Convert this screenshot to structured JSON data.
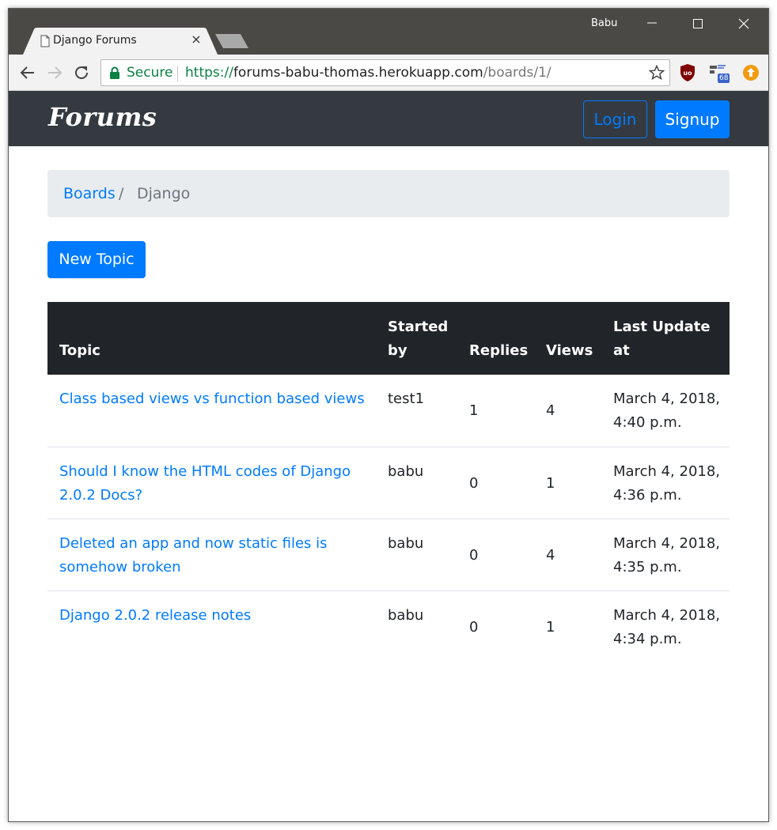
{
  "browser": {
    "tab_title": "Django Forums",
    "tab_close": "×",
    "profile_name": "Babu",
    "secure_label": "Secure",
    "url_scheme": "https://",
    "url_host": "forums-babu-thomas.herokuapp.com",
    "url_path": "/boards/1/",
    "extension_badge": "68"
  },
  "navbar": {
    "brand": "Forums",
    "login_label": "Login",
    "signup_label": "Signup"
  },
  "breadcrumb": {
    "link": "Boards",
    "separator": "/",
    "active": "Django"
  },
  "actions": {
    "new_topic_label": "New Topic"
  },
  "table": {
    "headers": {
      "topic": "Topic",
      "started_by": "Started by",
      "replies": "Replies",
      "views": "Views",
      "last_update": "Last Update at"
    },
    "rows": [
      {
        "topic": "Class based views vs function based views",
        "starter": "test1",
        "replies": "1",
        "views": "4",
        "last_update": "March 4, 2018, 4:40 p.m."
      },
      {
        "topic": "Should I know the HTML codes of Django 2.0.2 Docs?",
        "starter": "babu",
        "replies": "0",
        "views": "1",
        "last_update": "March 4, 2018, 4:36 p.m."
      },
      {
        "topic": "Deleted an app and now static files is somehow broken",
        "starter": "babu",
        "replies": "0",
        "views": "4",
        "last_update": "March 4, 2018, 4:35 p.m."
      },
      {
        "topic": "Django 2.0.2 release notes",
        "starter": "babu",
        "replies": "0",
        "views": "1",
        "last_update": "March 4, 2018, 4:34 p.m."
      }
    ]
  },
  "colors": {
    "primary": "#007bff",
    "navbar_bg": "#343a40",
    "table_header_bg": "#212529",
    "breadcrumb_bg": "#e9ecef",
    "secure_green": "#0b8043"
  },
  "icons": [
    "page-icon",
    "close-icon",
    "minimize-icon",
    "maximize-icon",
    "back-icon",
    "forward-icon",
    "reload-icon",
    "lock-icon",
    "star-icon",
    "ublock-icon",
    "extension-icon",
    "upload-icon"
  ]
}
